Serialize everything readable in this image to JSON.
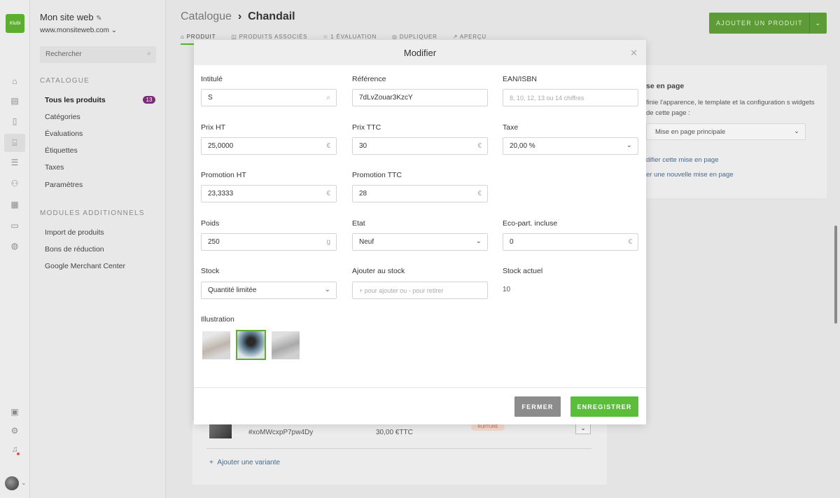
{
  "sidebar": {
    "site_name": "Mon site web",
    "site_url": "www.monsiteweb.com",
    "search_placeholder": "Rechercher",
    "section_catalogue": "CATALOGUE",
    "items": [
      {
        "label": "Tous les produits",
        "badge": "13"
      },
      {
        "label": "Catégories"
      },
      {
        "label": "Évaluations"
      },
      {
        "label": "Étiquettes"
      },
      {
        "label": "Taxes"
      },
      {
        "label": "Paramètres"
      }
    ],
    "section_modules": "MODULES ADDITIONNELS",
    "module_items": [
      "Import de produits",
      "Bons de réduction",
      "Google Merchant Center"
    ]
  },
  "header": {
    "breadcrumb_parent": "Catalogue",
    "breadcrumb_sep": "›",
    "breadcrumb_current": "Chandail",
    "tabs": [
      "PRODUIT",
      "PRODUITS ASSOCIÉS",
      "1 ÉVALUATION",
      "DUPLIQUER",
      "APERÇU"
    ],
    "add_button": "AJOUTER UN PRODUIT"
  },
  "right_panel": {
    "title": "se en page",
    "description": "finie l'apparence, le template et la configuration s widgets de cette page :",
    "select_value": "Mise en page principale",
    "link_edit": "difier cette mise en page",
    "link_new": "er une nouvelle mise en page"
  },
  "variants": {
    "ref": "#xoMWcxpP7pw4Dy",
    "price": "30,00 €TTC",
    "badge": "RUPTURE",
    "add_variant": "Ajouter une variante"
  },
  "modal": {
    "title": "Modifier",
    "fields": {
      "intitule": {
        "label": "Intitulé",
        "value": "S"
      },
      "reference": {
        "label": "Référence",
        "value": "7dLvZouar3KzcY"
      },
      "ean": {
        "label": "EAN/ISBN",
        "placeholder": "8, 10, 12, 13 ou 14 chiffres"
      },
      "prix_ht": {
        "label": "Prix HT",
        "value": "25,0000",
        "suffix": "€"
      },
      "prix_ttc": {
        "label": "Prix TTC",
        "value": "30",
        "suffix": "€"
      },
      "taxe": {
        "label": "Taxe",
        "value": "20,00 %"
      },
      "promo_ht": {
        "label": "Promotion HT",
        "value": "23,3333",
        "suffix": "€"
      },
      "promo_ttc": {
        "label": "Promotion TTC",
        "value": "28",
        "suffix": "€"
      },
      "poids": {
        "label": "Poids",
        "value": "250",
        "suffix": "g"
      },
      "etat": {
        "label": "Etat",
        "value": "Neuf"
      },
      "eco": {
        "label": "Eco-part. incluse",
        "value": "0",
        "suffix": "€"
      },
      "stock": {
        "label": "Stock",
        "value": "Quantité limitée"
      },
      "ajouter_stock": {
        "label": "Ajouter au stock",
        "placeholder": "+ pour ajouter ou - pour retirer"
      },
      "stock_actuel": {
        "label": "Stock actuel",
        "value": "10"
      }
    },
    "illustration_label": "Illustration",
    "close_button": "FERMER",
    "save_button": "ENREGISTRER"
  },
  "colors": {
    "accent": "#5cbd3a",
    "badge": "#7b2d7b"
  }
}
